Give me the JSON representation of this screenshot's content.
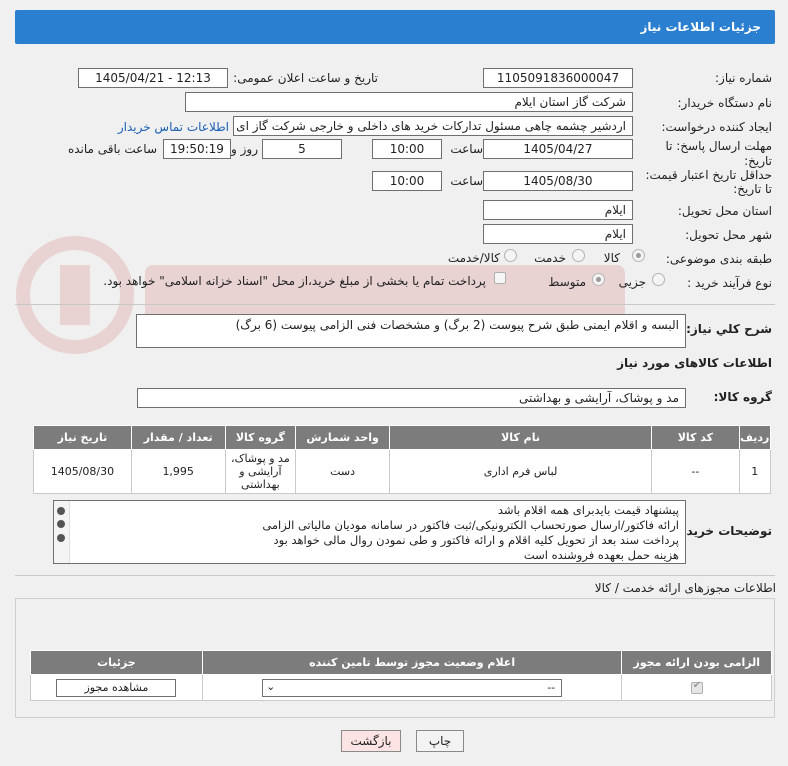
{
  "header": {
    "title": "جزئیات اطلاعات نیاز"
  },
  "form": {
    "need_number_label": "شماره نیاز:",
    "need_number_value": "1105091836000047",
    "announce_label": "تاریخ و ساعت اعلان عمومی:",
    "announce_value": "1405/04/21 - 12:13",
    "buyer_org_label": "نام دستگاه خریدار:",
    "buyer_org_value": "شرکت گاز استان ایلام",
    "requester_label": "ایجاد کننده درخواست:",
    "requester_value": "اردشیر چشمه چاهی مسئول تدارکات خرید های داخلی و خارجی  شرکت گاز ای",
    "contact_link": "اطلاعات تماس خریدار",
    "reply_deadline_label_1": "مهلت ارسال پاسخ: تا",
    "reply_deadline_label_2": "تاریخ:",
    "reply_date": "1405/04/27",
    "time_label": "ساعت",
    "reply_time": "10:00",
    "days_value": "5",
    "days_label": "روز و",
    "remaining_time": "19:50:19",
    "remaining_label": "ساعت باقی مانده",
    "price_validity_label_1": "حداقل تاریخ اعتبار قیمت:",
    "price_validity_label_2": "تا تاریخ:",
    "price_date": "1405/08/30",
    "price_time": "10:00",
    "province_label": "استان محل تحویل:",
    "province_value": "ایلام",
    "city_label": "شهر محل تحویل:",
    "city_value": "ایلام",
    "category_label": "طبقه بندی موضوعی:",
    "category_options": [
      "کالا",
      "خدمت",
      "کالا/خدمت"
    ],
    "process_label": "نوع فرآیند خرید :",
    "process_options": [
      "جزیی",
      "متوسط"
    ],
    "payment_text": "پرداخت تمام یا بخشی از مبلغ خرید،از محل \"اسناد خزانه اسلامی\" خواهد بود."
  },
  "description": {
    "label": "شرح کلي نياز:",
    "value": "البسه و اقلام ایمنی طبق شرح پیوست (2 برگ) و مشخصات فنی الزامی پیوست (6 برگ)"
  },
  "goods": {
    "section_title": "اطلاعات کالاهای مورد نیاز",
    "group_label": "گروه کالا:",
    "group_value": "مد و پوشاک، آرایشی و بهداشتی",
    "columns": [
      "ردیف",
      "کد کالا",
      "نام کالا",
      "واحد شمارش",
      "گروه کالا",
      "تعداد / مقدار",
      "تاریخ نیاز"
    ],
    "rows": [
      {
        "row": "1",
        "code": "--",
        "name": "لباس فرم اداری",
        "unit": "دست",
        "group": "مد و پوشاک، آرایشی و بهداشتی",
        "qty": "1,995",
        "date": "1405/08/30"
      }
    ]
  },
  "buyer_notes": {
    "label": "توضیحات خریدار:",
    "lines": [
      "پیشنهاد قیمت بایدبرای همه اقلام باشد",
      "ارائه فاکتور/ارسال صورتحساب الکترونیکی/ثبت فاکتور در سامانه مودیان مالیاتی الزامی",
      "پرداخت سند بعد از تحویل کلیه اقلام و ارائه فاکتور و طی نمودن روال مالی خواهد بود",
      "هزینه حمل بعهده فروشنده است"
    ]
  },
  "permits": {
    "title": "اطلاعات مجوزهای ارائه خدمت / کالا",
    "columns": [
      "الزامی بودن ارائه مجوز",
      "اعلام وضعیت مجوز توسط تامین کننده",
      "جزئیات"
    ],
    "select_value": "--",
    "view_button": "مشاهده مجوز"
  },
  "footer": {
    "print_button": "چاپ",
    "back_button": "بازگشت"
  }
}
